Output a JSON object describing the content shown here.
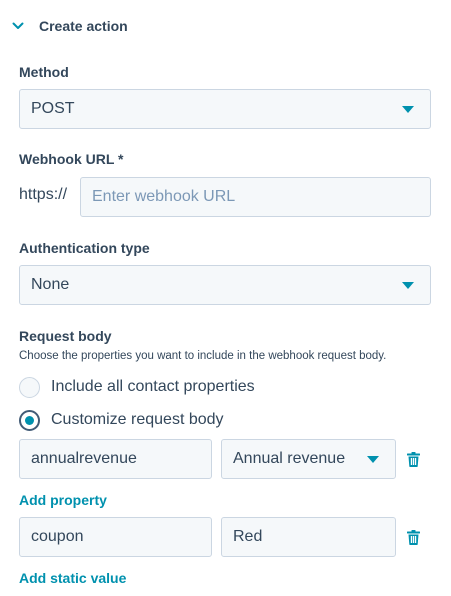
{
  "section": {
    "title": "Create action",
    "icon": "chevron-down-icon"
  },
  "method": {
    "label": "Method",
    "value": "POST"
  },
  "webhook": {
    "label": "Webhook URL *",
    "prefix": "https://",
    "placeholder": "Enter webhook URL",
    "value": ""
  },
  "auth": {
    "label": "Authentication type",
    "value": "None"
  },
  "request_body": {
    "label": "Request body",
    "help": "Choose the properties you want to include in the webhook request body.",
    "options": [
      {
        "label": "Include all contact properties",
        "selected": false
      },
      {
        "label": "Customize request body",
        "selected": true
      }
    ],
    "property_row": {
      "key": "annualrevenue",
      "value": "Annual revenue"
    },
    "add_property_label": "Add property",
    "static_row": {
      "key": "coupon",
      "value": "Red"
    },
    "add_static_label": "Add static value"
  },
  "colors": {
    "accent": "#0091ae",
    "text": "#33475b",
    "field_bg": "#f5f8fa",
    "field_border": "#cbd6e2"
  }
}
